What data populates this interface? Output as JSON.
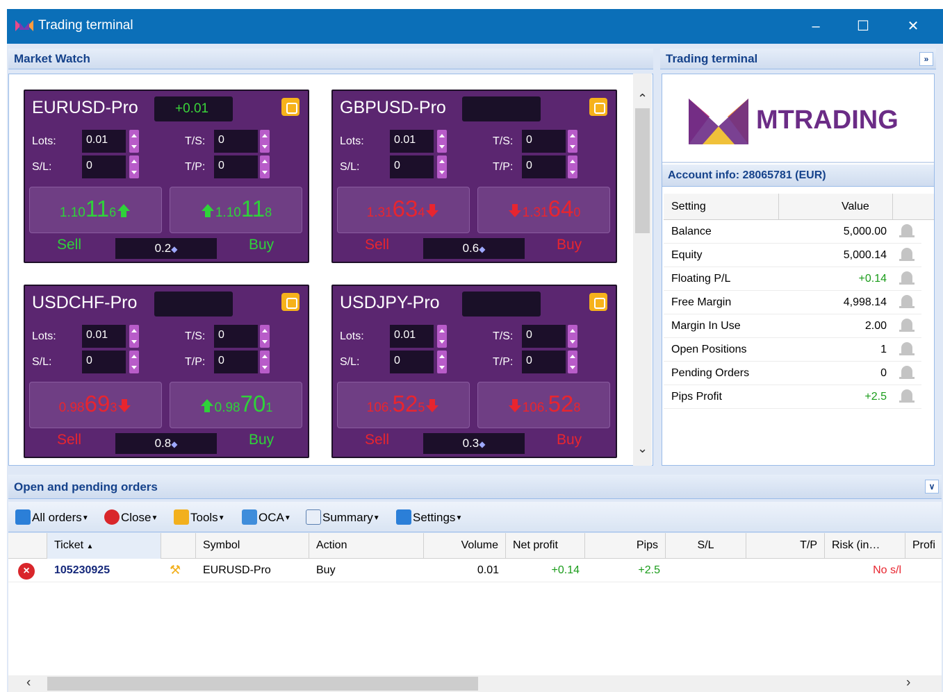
{
  "window": {
    "title": "Trading terminal"
  },
  "market_watch": {
    "title": "Market Watch",
    "tiles": [
      {
        "symbol": "EURUSD-Pro",
        "change": "+0.01",
        "lots_label": "Lots:",
        "lots": "0.01",
        "ts_label": "T/S:",
        "ts": "0",
        "sl_label": "S/L:",
        "sl": "0",
        "tp_label": "T/P:",
        "tp": "0",
        "sell_pre": "1.10",
        "sell_big": "11",
        "sell_small": "6",
        "sell_dir": "up",
        "buy_pre": "1.10",
        "buy_big": "11",
        "buy_small": "8",
        "buy_dir": "up",
        "sell_label": "Sell",
        "buy_label": "Buy",
        "spread": "0.2"
      },
      {
        "symbol": "GBPUSD-Pro",
        "change": "",
        "lots_label": "Lots:",
        "lots": "0.01",
        "ts_label": "T/S:",
        "ts": "0",
        "sl_label": "S/L:",
        "sl": "0",
        "tp_label": "T/P:",
        "tp": "0",
        "sell_pre": "1.31",
        "sell_big": "63",
        "sell_small": "4",
        "sell_dir": "down",
        "buy_pre": "1.31",
        "buy_big": "64",
        "buy_small": "0",
        "buy_dir": "down",
        "sell_label": "Sell",
        "buy_label": "Buy",
        "spread": "0.6"
      },
      {
        "symbol": "USDCHF-Pro",
        "change": "",
        "lots_label": "Lots:",
        "lots": "0.01",
        "ts_label": "T/S:",
        "ts": "0",
        "sl_label": "S/L:",
        "sl": "0",
        "tp_label": "T/P:",
        "tp": "0",
        "sell_pre": "0.98",
        "sell_big": "69",
        "sell_small": "3",
        "sell_dir": "down",
        "buy_pre": "0.98",
        "buy_big": "70",
        "buy_small": "1",
        "buy_dir": "up",
        "sell_label": "Sell",
        "buy_label": "Buy",
        "spread": "0.8"
      },
      {
        "symbol": "USDJPY-Pro",
        "change": "",
        "lots_label": "Lots:",
        "lots": "0.01",
        "ts_label": "T/S:",
        "ts": "0",
        "sl_label": "S/L:",
        "sl": "0",
        "tp_label": "T/P:",
        "tp": "0",
        "sell_pre": "106.",
        "sell_big": "52",
        "sell_small": "5",
        "sell_dir": "down",
        "buy_pre": "106.",
        "buy_big": "52",
        "buy_small": "8",
        "buy_dir": "down",
        "sell_label": "Sell",
        "buy_label": "Buy",
        "spread": "0.3"
      }
    ]
  },
  "trading_terminal": {
    "title": "Trading terminal",
    "brand": "MTRADING",
    "account_header": "Account info: 28065781 (EUR)",
    "table_headers": {
      "setting": "Setting",
      "value": "Value"
    },
    "rows": [
      {
        "key": "Balance",
        "value": "5,000.00",
        "positive": false
      },
      {
        "key": "Equity",
        "value": "5,000.14",
        "positive": false
      },
      {
        "key": "Floating P/L",
        "value": "+0.14",
        "positive": true
      },
      {
        "key": "Free Margin",
        "value": "4,998.14",
        "positive": false
      },
      {
        "key": "Margin In Use",
        "value": "2.00",
        "positive": false
      },
      {
        "key": "Open Positions",
        "value": "1",
        "positive": false
      },
      {
        "key": "Pending Orders",
        "value": "0",
        "positive": false
      },
      {
        "key": "Pips Profit",
        "value": "+2.5",
        "positive": true
      }
    ]
  },
  "orders": {
    "title": "Open and pending orders",
    "toolbar": {
      "all_orders": "All orders",
      "close": "Close",
      "tools": "Tools",
      "oca": "OCA",
      "summary": "Summary",
      "settings": "Settings"
    },
    "columns": {
      "ticket": "Ticket",
      "symbol": "Symbol",
      "action": "Action",
      "volume": "Volume",
      "net_profit": "Net profit",
      "pips": "Pips",
      "sl": "S/L",
      "tp": "T/P",
      "risk": "Risk (in…",
      "profit": "Profi"
    },
    "rows": [
      {
        "ticket": "105230925",
        "symbol": "EURUSD-Pro",
        "action": "Buy",
        "volume": "0.01",
        "net_profit": "+0.14",
        "pips": "+2.5",
        "sl": "",
        "tp": "",
        "risk": "No s/l"
      }
    ]
  },
  "colors": {
    "titlebar": "#0b6fb8",
    "tile_bg": "#5b2670",
    "up": "#2fd23a",
    "down": "#e8252f",
    "brand": "#6b2c86"
  }
}
